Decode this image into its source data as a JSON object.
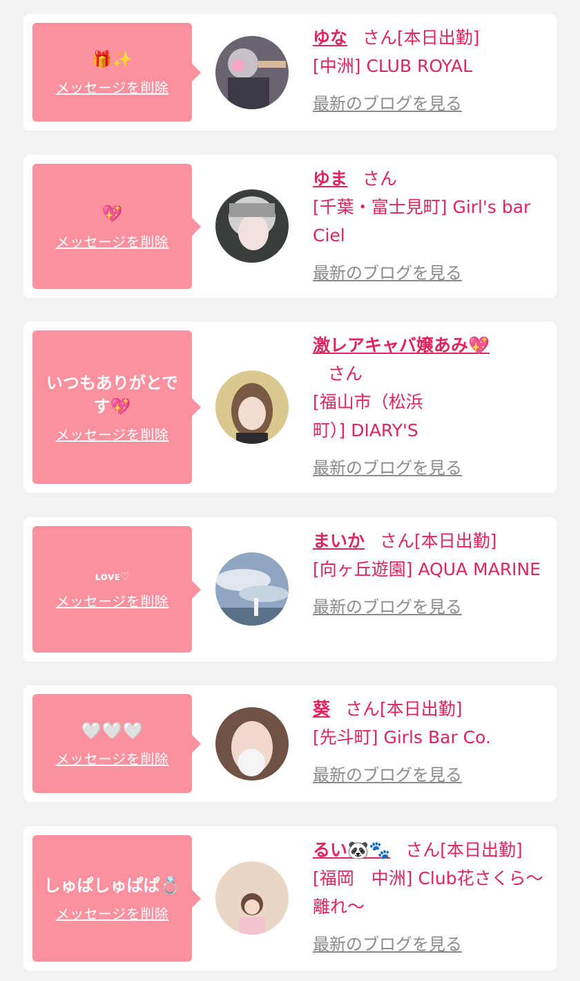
{
  "delete_label": "メッセージを削除",
  "blog_label": "最新のブログを見る",
  "cards": [
    {
      "message": "🎁✨",
      "name": "ゆな",
      "honorific": "さん",
      "status": "[本日出勤]",
      "shop": "[中洲] CLUB ROYAL",
      "avatar_icon": "avatar-photo-icon"
    },
    {
      "message": "💖",
      "name": "ゆま",
      "honorific": "さん",
      "status": "",
      "shop": "[千葉・富士見町] Girl's bar Ciel",
      "avatar_icon": "avatar-photo-icon"
    },
    {
      "message": "いつもありがとです💖",
      "name": "激レアキャバ嬢あみ💖",
      "honorific": "さん",
      "status": "",
      "shop": "[福山市（松浜町）] DIARY'S",
      "avatar_icon": "avatar-photo-icon"
    },
    {
      "message": "ʟᴏᴠᴇ♡",
      "name": "まいか",
      "honorific": "さん",
      "status": "[本日出勤]",
      "shop": "[向ヶ丘遊園] AQUA MARINE",
      "avatar_icon": "avatar-photo-icon"
    },
    {
      "message": "🤍🤍🤍",
      "name": "葵",
      "honorific": "さん",
      "status": "[本日出勤]",
      "shop": "[先斗町] Girls Bar Co.",
      "avatar_icon": "avatar-photo-icon"
    },
    {
      "message": "しゅぱしゅぱぱ💍",
      "name": "るい🐼🐾",
      "honorific": "さん",
      "status": "[本日出勤]",
      "shop": "[福岡　中洲] Club花さくら〜離れ〜",
      "avatar_icon": "avatar-photo-icon"
    }
  ],
  "colors": {
    "accent": "#e0245e",
    "bubble": "#fb909e",
    "card": "#ffffff",
    "background": "#f2f2f3"
  }
}
